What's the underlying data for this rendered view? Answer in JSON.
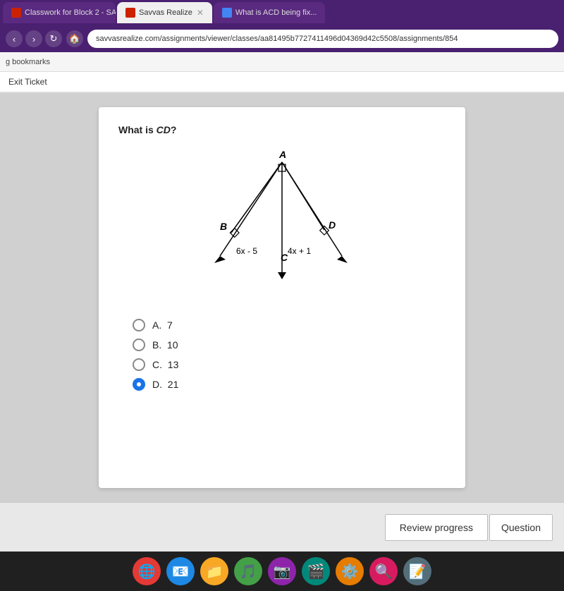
{
  "browser": {
    "tabs": [
      {
        "id": "tab1",
        "label": "Classwork for Block 2 - SA",
        "favicon": "savvas",
        "active": false
      },
      {
        "id": "tab2",
        "label": "Savvas Realize",
        "favicon": "savvas",
        "active": true
      },
      {
        "id": "tab3",
        "label": "What is ACD being fix...",
        "favicon": "google",
        "active": false
      }
    ],
    "address": "savvasrealize.com/assignments/viewer/classes/aa81495b7727411496d04369d42c5508/assignments/854",
    "bookmarks_label": "g bookmarks"
  },
  "page": {
    "header": "Exit Ticket"
  },
  "question": {
    "label": "What is CD?",
    "diagram_labels": {
      "A": "A",
      "B": "B",
      "C": "C",
      "D": "D",
      "left_expr": "6x - 5",
      "right_expr": "4x + 1"
    },
    "options": [
      {
        "letter": "A",
        "value": "7",
        "selected": false
      },
      {
        "letter": "B",
        "value": "10",
        "selected": false
      },
      {
        "letter": "C",
        "value": "13",
        "selected": false
      },
      {
        "letter": "D",
        "value": "21",
        "selected": true
      }
    ]
  },
  "footer": {
    "review_progress_label": "Review progress",
    "question_label": "Question"
  },
  "taskbar": {
    "icons": [
      "🌐",
      "📧",
      "📁",
      "🎵",
      "📷",
      "🎬",
      "⚙️",
      "🔍",
      "📝"
    ]
  }
}
